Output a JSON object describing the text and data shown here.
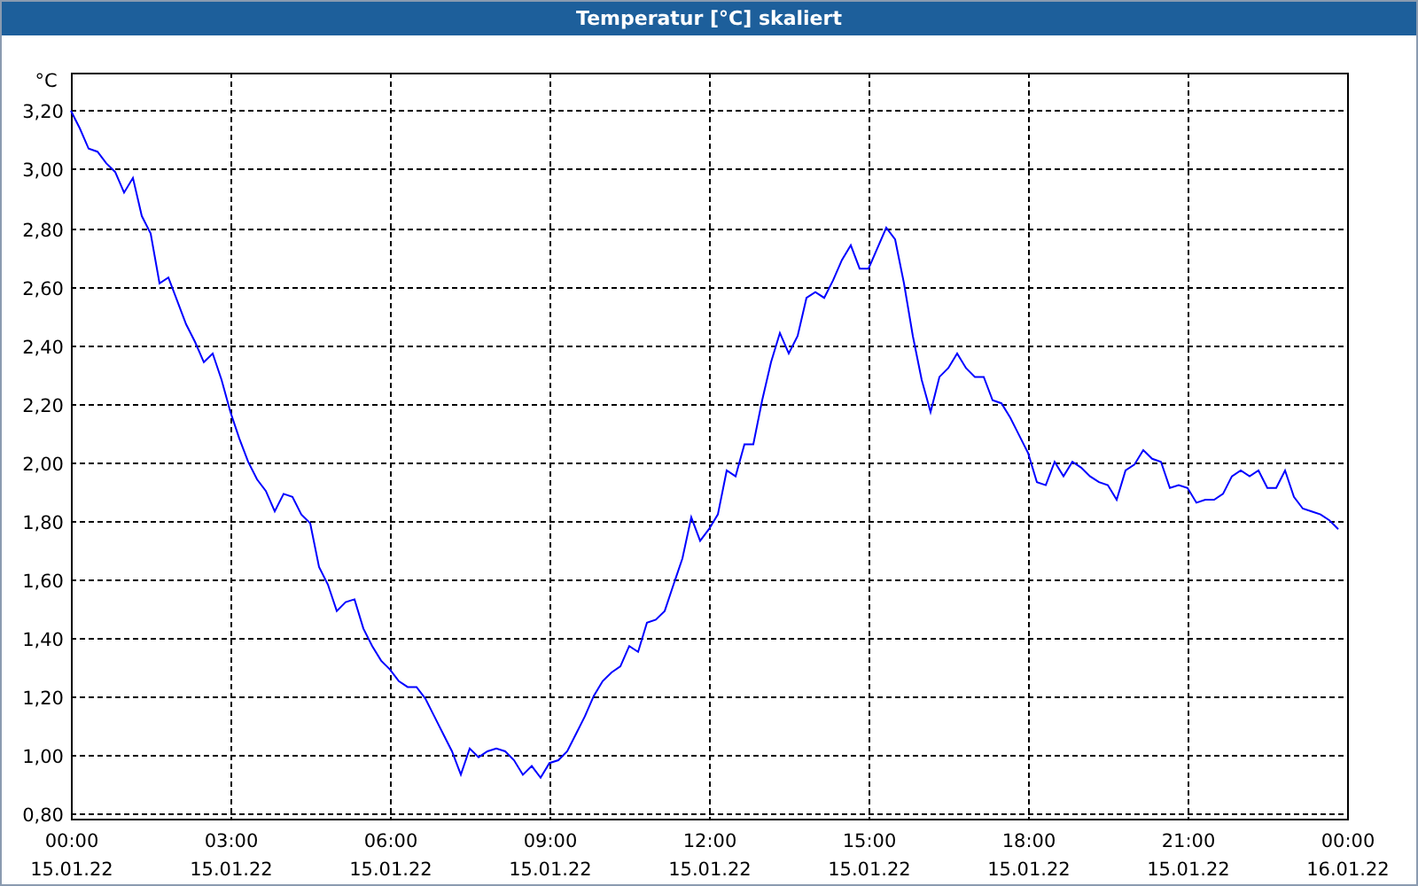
{
  "window": {
    "title": "Temperatur [°C] skaliert"
  },
  "chart": {
    "chart_data": {
      "type": "line",
      "ylabel": "°C",
      "grid": true,
      "ylim": [
        0.78,
        3.33
      ],
      "yticks": [
        {
          "value": 0.8,
          "label": "0,80"
        },
        {
          "value": 1.0,
          "label": "1,00"
        },
        {
          "value": 1.2,
          "label": "1,20"
        },
        {
          "value": 1.4,
          "label": "1,40"
        },
        {
          "value": 1.6,
          "label": "1,60"
        },
        {
          "value": 1.8,
          "label": "1,80"
        },
        {
          "value": 2.0,
          "label": "2,00"
        },
        {
          "value": 2.2,
          "label": "2,20"
        },
        {
          "value": 2.4,
          "label": "2,40"
        },
        {
          "value": 2.6,
          "label": "2,60"
        },
        {
          "value": 2.8,
          "label": "2,80"
        },
        {
          "value": 3.0,
          "label": "3,00"
        },
        {
          "value": 3.2,
          "label": "3,20"
        }
      ],
      "categories": [
        "00:00 15.01.22",
        null,
        null,
        null,
        null,
        null,
        null,
        null,
        null,
        null,
        null,
        null,
        null,
        null,
        null,
        null,
        null,
        null,
        "03:00 15.01.22",
        null,
        null,
        null,
        null,
        null,
        null,
        null,
        null,
        null,
        null,
        null,
        null,
        null,
        null,
        null,
        null,
        null,
        "06:00 15.01.22",
        null,
        null,
        null,
        null,
        null,
        null,
        null,
        null,
        null,
        null,
        null,
        null,
        null,
        null,
        null,
        null,
        null,
        "09:00 15.01.22",
        null,
        null,
        null,
        null,
        null,
        null,
        null,
        null,
        null,
        null,
        null,
        null,
        null,
        null,
        null,
        null,
        null,
        "12:00 15.01.22",
        null,
        null,
        null,
        null,
        null,
        null,
        null,
        null,
        null,
        null,
        null,
        null,
        null,
        null,
        null,
        null,
        null,
        "15:00 15.01.22",
        null,
        null,
        null,
        null,
        null,
        null,
        null,
        null,
        null,
        null,
        null,
        null,
        null,
        null,
        null,
        null,
        null,
        "18:00 15.01.22",
        null,
        null,
        null,
        null,
        null,
        null,
        null,
        null,
        null,
        null,
        null,
        null,
        null,
        null,
        null,
        null,
        null,
        "21:00 15.01.22",
        null,
        null,
        null,
        null,
        null,
        null,
        null,
        null,
        null,
        null,
        null,
        null,
        null,
        null,
        null,
        null,
        null,
        "00:00 16.01.22"
      ],
      "series": [
        {
          "color": "#0000ff",
          "values": [
            3.2,
            3.14,
            3.07,
            3.06,
            3.02,
            2.99,
            2.92,
            2.97,
            2.84,
            2.78,
            2.61,
            2.63,
            2.55,
            2.47,
            2.41,
            2.34,
            2.37,
            2.28,
            2.17,
            2.08,
            2.0,
            1.94,
            1.9,
            1.83,
            1.89,
            1.88,
            1.82,
            1.79,
            1.64,
            1.58,
            1.49,
            1.52,
            1.53,
            1.43,
            1.37,
            1.32,
            1.29,
            1.25,
            1.23,
            1.23,
            1.19,
            1.13,
            1.07,
            1.01,
            0.93,
            1.02,
            0.99,
            1.01,
            1.02,
            1.01,
            0.98,
            0.93,
            0.96,
            0.92,
            0.97,
            0.98,
            1.01,
            1.07,
            1.13,
            1.2,
            1.25,
            1.28,
            1.3,
            1.37,
            1.35,
            1.45,
            1.46,
            1.49,
            1.58,
            1.67,
            1.81,
            1.73,
            1.77,
            1.82,
            1.97,
            1.95,
            2.06,
            2.06,
            2.21,
            2.34,
            2.44,
            2.37,
            2.43,
            2.56,
            2.58,
            2.56,
            2.62,
            2.69,
            2.74,
            2.66,
            2.66,
            2.73,
            2.8,
            2.76,
            2.61,
            2.43,
            2.28,
            2.17,
            2.29,
            2.32,
            2.37,
            2.32,
            2.29,
            2.29,
            2.21,
            2.2,
            2.15,
            2.09,
            2.03,
            1.93,
            1.92,
            2.0,
            1.95,
            2.0,
            1.98,
            1.95,
            1.93,
            1.92,
            1.87,
            1.97,
            1.99,
            2.04,
            2.01,
            2.0,
            1.91,
            1.92,
            1.91,
            1.86,
            1.87,
            1.87,
            1.89,
            1.95,
            1.97,
            1.95,
            1.97,
            1.91,
            1.91,
            1.97,
            1.88,
            1.84,
            1.83,
            1.82,
            1.8,
            1.77,
            null
          ]
        }
      ]
    }
  }
}
